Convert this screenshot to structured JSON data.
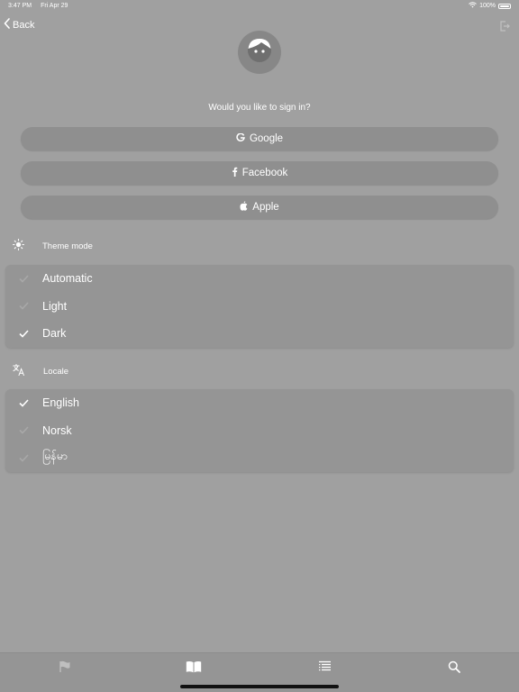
{
  "status_bar": {
    "time": "3:47 PM",
    "date": "Fri Apr 29",
    "battery": "100%"
  },
  "nav": {
    "back_label": "Back"
  },
  "signin": {
    "prompt": "Would you like to sign in?",
    "buttons": [
      {
        "label": "Google",
        "icon": "google-icon"
      },
      {
        "label": "Facebook",
        "icon": "facebook-icon"
      },
      {
        "label": "Apple",
        "icon": "apple-icon"
      }
    ]
  },
  "theme": {
    "title": "Theme mode",
    "options": [
      {
        "label": "Automatic",
        "selected": false
      },
      {
        "label": "Light",
        "selected": false
      },
      {
        "label": "Dark",
        "selected": true
      }
    ]
  },
  "locale": {
    "title": "Locale",
    "options": [
      {
        "label": "English",
        "selected": true
      },
      {
        "label": "Norsk",
        "selected": false
      },
      {
        "label": "မြန်မာ",
        "selected": false
      }
    ]
  },
  "tabs": [
    {
      "icon": "flag-icon"
    },
    {
      "icon": "book-icon"
    },
    {
      "icon": "list-icon"
    },
    {
      "icon": "search-icon"
    }
  ],
  "colors": {
    "background": "#a0a0a0",
    "card": "#959595",
    "button": "#8f8f8f",
    "text": "#ffffff"
  }
}
